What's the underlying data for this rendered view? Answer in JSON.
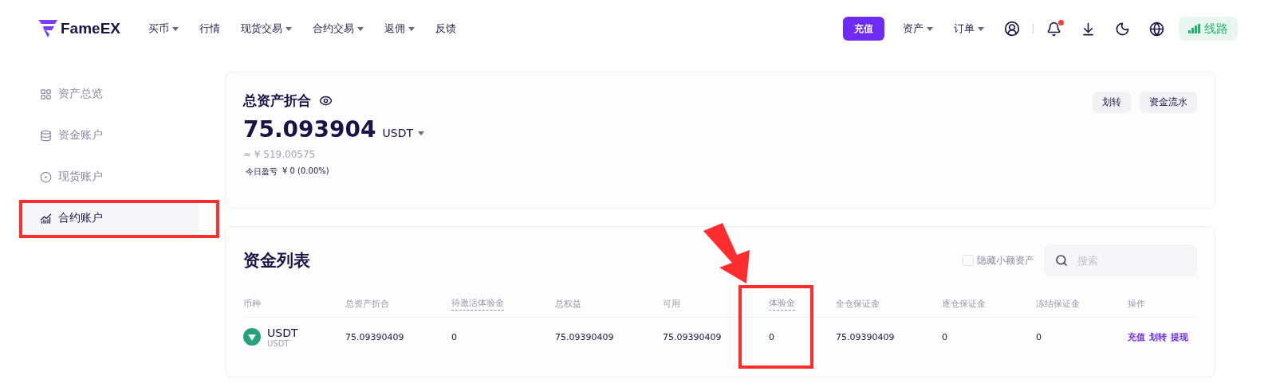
{
  "header": {
    "logo": "FameEX",
    "nav": [
      {
        "label": "买币",
        "dropdown": true
      },
      {
        "label": "行情",
        "dropdown": false
      },
      {
        "label": "现货交易",
        "dropdown": true
      },
      {
        "label": "合约交易",
        "dropdown": true
      },
      {
        "label": "返佣",
        "dropdown": true
      },
      {
        "label": "反馈",
        "dropdown": false
      }
    ],
    "deposit_button": "充值",
    "menus": [
      {
        "label": "资产",
        "dropdown": true
      },
      {
        "label": "订单",
        "dropdown": true
      }
    ],
    "notifications": {
      "unread": true
    },
    "route_button": "线路"
  },
  "sidebar": {
    "items": [
      {
        "label": "资产总览",
        "selected": false
      },
      {
        "label": "资金账户",
        "selected": false
      },
      {
        "label": "现货账户",
        "selected": false
      },
      {
        "label": "合约账户",
        "selected": true
      }
    ]
  },
  "summary": {
    "title": "总资产折合",
    "amount": "75.093904",
    "unit": "USDT",
    "fiat": "≈ ¥ 519.00575",
    "pnl_label": "今日盈亏",
    "pnl_value": "¥ 0 (0.00%)",
    "buttons": [
      "划转",
      "资金流水"
    ]
  },
  "funds": {
    "title": "资金列表",
    "hide_small": {
      "label": "隐藏小额资产",
      "checked": false
    },
    "search": {
      "placeholder": "搜索"
    },
    "columns": [
      {
        "label": "币种",
        "dotted_underline": false
      },
      {
        "label": "总资产折合",
        "dotted_underline": false
      },
      {
        "label": "待激活体验金",
        "dotted_underline": true
      },
      {
        "label": "总权益",
        "dotted_underline": false
      },
      {
        "label": "可用",
        "dotted_underline": false
      },
      {
        "label": "体验金",
        "dotted_underline": true
      },
      {
        "label": "全仓保证金",
        "dotted_underline": false
      },
      {
        "label": "逐仓保证金",
        "dotted_underline": false
      },
      {
        "label": "冻结保证金",
        "dotted_underline": false
      },
      {
        "label": "操作",
        "dotted_underline": false
      }
    ],
    "rows": [
      {
        "cells": [
          {
            "kind": "coin",
            "text": "USDT",
            "sub": "USDT"
          },
          {
            "kind": "text",
            "text": "75.09390409"
          },
          {
            "kind": "text",
            "text": "0"
          },
          {
            "kind": "text",
            "text": "75.09390409"
          },
          {
            "kind": "text",
            "text": "75.09390409"
          },
          {
            "kind": "text",
            "text": "0"
          },
          {
            "kind": "text",
            "text": "75.09390409"
          },
          {
            "kind": "text",
            "text": "0"
          },
          {
            "kind": "text",
            "text": "0"
          },
          {
            "kind": "actions",
            "links": [
              "充值",
              "划转",
              "提现"
            ]
          }
        ]
      }
    ]
  }
}
